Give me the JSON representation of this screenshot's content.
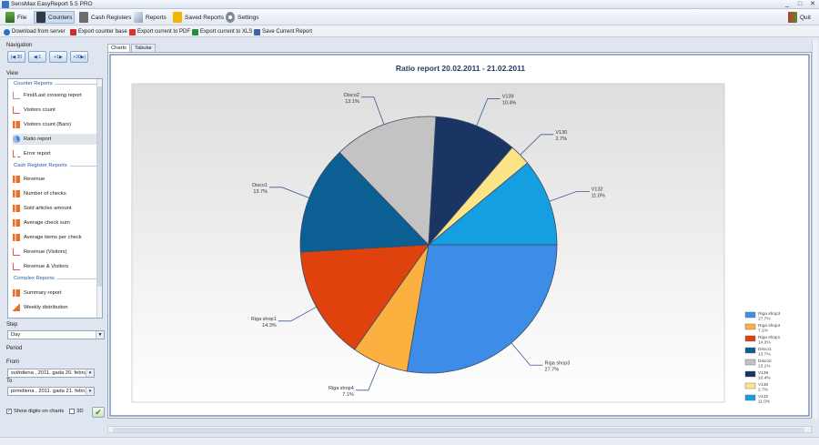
{
  "window": {
    "title": "SensMax EasyReport 5.5 PRO",
    "controls": [
      "_",
      "□",
      "✕"
    ]
  },
  "menu": {
    "items": [
      {
        "label": "File",
        "icon": "file-icon"
      },
      {
        "label": "Counters",
        "icon": "counter-icon"
      },
      {
        "label": "Cash Registers",
        "icon": "cash-register-icon"
      },
      {
        "label": "Reports",
        "icon": "reports-icon"
      },
      {
        "label": "Saved Reports",
        "icon": "saved-reports-icon"
      },
      {
        "label": "Settings",
        "icon": "gear-icon"
      }
    ],
    "quit_label": "Quit"
  },
  "toolbar": {
    "items": [
      {
        "label": "Download from server",
        "icon": "download-icon"
      },
      {
        "label": "Export counter base",
        "icon": "export-icon"
      },
      {
        "label": "Export current to PDF",
        "icon": "pdf-icon"
      },
      {
        "label": "Export current to XLS",
        "icon": "xls-icon"
      },
      {
        "label": "Save Current Report",
        "icon": "save-icon"
      }
    ]
  },
  "navigation": {
    "label": "Navigation",
    "buttons": [
      "-30",
      "-1",
      "+1",
      "+30"
    ]
  },
  "view": {
    "label": "View",
    "sections": [
      {
        "title": "Counter Reports",
        "items": [
          "First/Last crossing report",
          "Visitors count",
          "Visitors count (Bars)",
          "Ratio report",
          "Error report"
        ]
      },
      {
        "title": "Cash Register Reports",
        "items": [
          "Revenue",
          "Number of checks",
          "Sold articles amount",
          "Average check sum",
          "Average items per check",
          "Revenue (Visitors)",
          "Revenue & Visitors"
        ]
      },
      {
        "title": "Complex Reports",
        "items": [
          "Summary report",
          "Weekly distribution"
        ]
      }
    ],
    "selected": "Ratio report"
  },
  "step": {
    "label": "Step",
    "value": "Day"
  },
  "period": {
    "label": "Period",
    "from_label": "From",
    "from_value": "svētdiena , 2011. gada 20. februārī",
    "to_label": "To",
    "to_value": "pirmdiena , 2011. gada 21. februārī"
  },
  "options": {
    "show_digits_label": "Show digits on charts",
    "show_digits_checked": true,
    "three_d_label": "3D",
    "three_d_checked": false
  },
  "tabs": [
    "Charts",
    "Tabular"
  ],
  "active_tab": "Charts",
  "chart_data": {
    "type": "pie",
    "title": "Ratio report 20.02.2011 - 21.02.2011",
    "slices": [
      {
        "label": "Riga shop3",
        "value": 27.7,
        "text": "27.7%",
        "color": "#3d8de8"
      },
      {
        "label": "Riga shop4",
        "value": 7.1,
        "text": "7.1%",
        "color": "#fbb040"
      },
      {
        "label": "Riga shop1",
        "value": 14.3,
        "text": "14.3%",
        "color": "#e0420e"
      },
      {
        "label": "Disco1",
        "value": 13.7,
        "text": "13.7%",
        "color": "#0b5f93"
      },
      {
        "label": "Disco2",
        "value": 13.1,
        "text": "13.1%",
        "color": "#c3c3c3"
      },
      {
        "label": "V139",
        "value": 10.4,
        "text": "10.4%",
        "color": "#1a3563"
      },
      {
        "label": "V130",
        "value": 2.7,
        "text": "2.7%",
        "color": "#fce386"
      },
      {
        "label": "V132",
        "value": 11.0,
        "text": "11.0%",
        "color": "#159fe0"
      }
    ],
    "legend_placement": "right"
  }
}
